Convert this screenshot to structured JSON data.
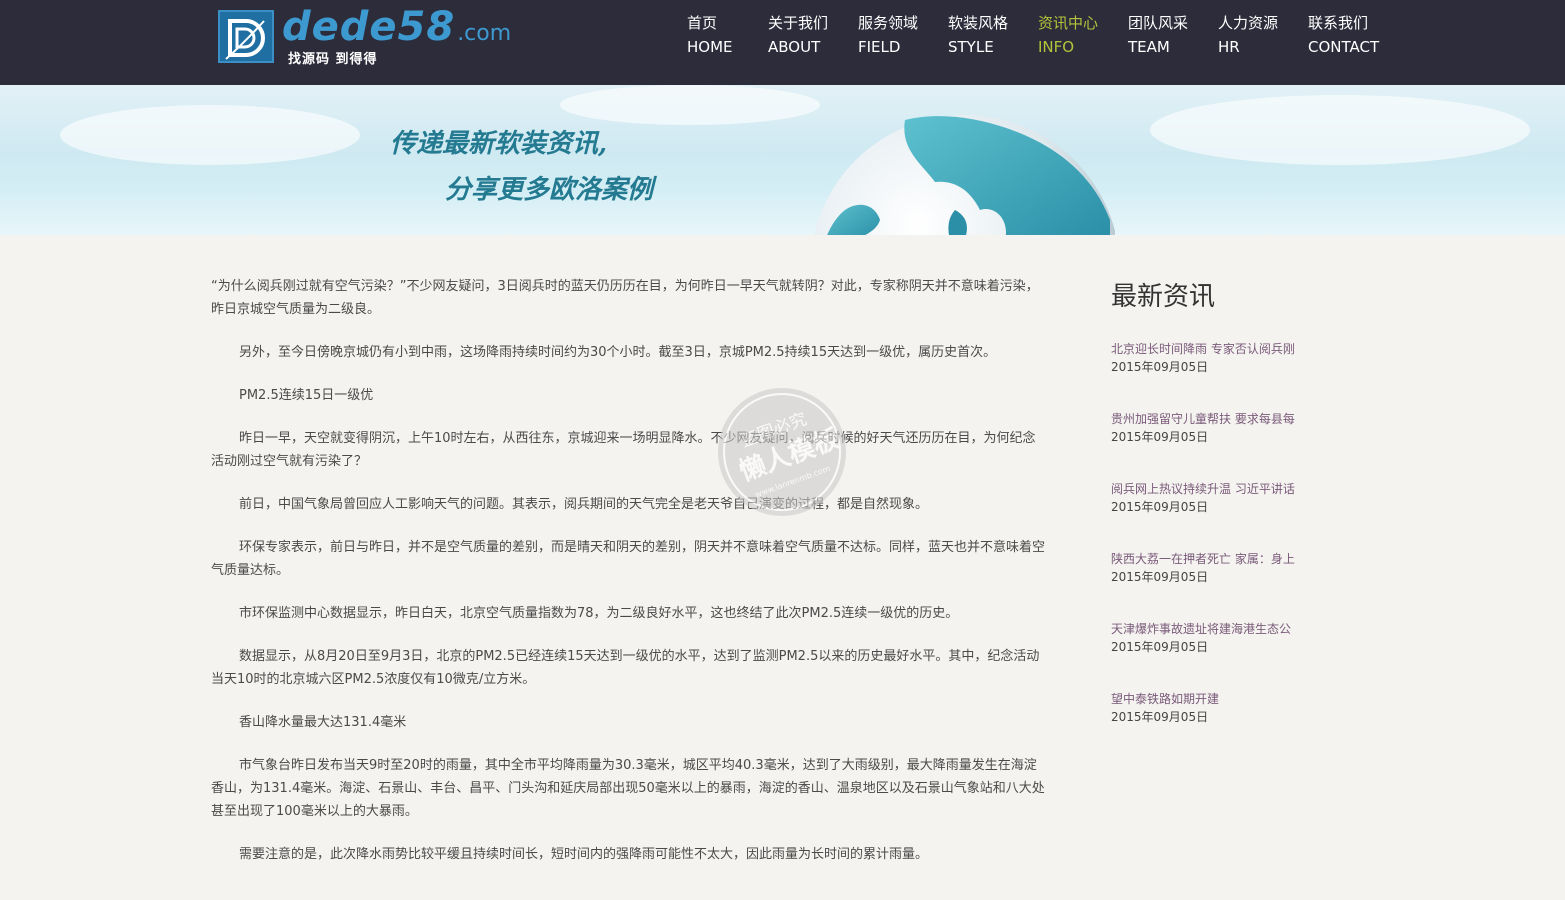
{
  "header": {
    "logo": {
      "icon": "dede-logo-icon",
      "brand": "dede58",
      "domain_suffix": ".com",
      "slogan": "找源码 到得得"
    },
    "nav": [
      {
        "cn": "首页",
        "en": "HOME",
        "active": false
      },
      {
        "cn": "关于我们",
        "en": "ABOUT",
        "active": false
      },
      {
        "cn": "服务领域",
        "en": "FIELD",
        "active": false
      },
      {
        "cn": "软装风格",
        "en": "STYLE",
        "active": false
      },
      {
        "cn": "资讯中心",
        "en": "INFO",
        "active": true
      },
      {
        "cn": "团队风采",
        "en": "TEAM",
        "active": false
      },
      {
        "cn": "人力资源",
        "en": "HR",
        "active": false
      },
      {
        "cn": "联系我们",
        "en": "CONTACT",
        "active": false
      }
    ]
  },
  "banner": {
    "line1": "传递最新软装资讯,",
    "line2": "分享更多欧洛案例",
    "image": "globe-icon"
  },
  "article": {
    "paragraphs": [
      "“为什么阅兵刚过就有空气污染？”不少网友疑问，3日阅兵时的蓝天仍历历在目，为何昨日一早天气就转阴？对此，专家称阴天并不意味着污染，昨日京城空气质量为二级良。",
      "另外，至今日傍晚京城仍有小到中雨，这场降雨持续时间约为30个小时。截至3日，京城PM2.5持续15天达到一级优，属历史首次。",
      "PM2.5连续15日一级优",
      "昨日一早，天空就变得阴沉，上午10时左右，从西往东，京城迎来一场明显降水。不少网友疑问，阅兵时候的好天气还历历在目，为何纪念活动刚过空气就有污染了？",
      "前日，中国气象局曾回应人工影响天气的问题。其表示，阅兵期间的天气完全是老天爷自己演变的过程，都是自然现象。",
      "环保专家表示，前日与昨日，并不是空气质量的差别，而是晴天和阴天的差别，阴天并不意味着空气质量不达标。同样，蓝天也并不意味着空气质量达标。",
      "市环保监测中心数据显示，昨日白天，北京空气质量指数为78，为二级良好水平，这也终结了此次PM2.5连续一级优的历史。",
      "数据显示，从8月20日至9月3日，北京的PM2.5已经连续15天达到一级优的水平，达到了监测PM2.5以来的历史最好水平。其中，纪念活动当天10时的北京城六区PM2.5浓度仅有10微克/立方米。",
      "香山降水量最大达131.4毫米",
      "市气象台昨日发布当天9时至20时的雨量，其中全市平均降雨量为30.3毫米，城区平均40.3毫米，达到了大雨级别，最大降雨量发生在海淀香山，为131.4毫米。海淀、石景山、丰台、昌平、门头沟和延庆局部出现50毫米以上的暴雨，海淀的香山、温泉地区以及石景山气象站和八大处甚至出现了100毫米以上的大暴雨。",
      "需要注意的是，此次降水雨势比较平缓且持续时间长，短时间内的强降雨可能性不太大，因此雨量为长时间的累计雨量。"
    ]
  },
  "sidebar": {
    "title": "最新资讯",
    "items": [
      {
        "title": "北京迎长时间降雨 专家否认阅兵刚",
        "date": "2015年09月05日"
      },
      {
        "title": "贵州加强留守儿童帮扶 要求每县每",
        "date": "2015年09月05日"
      },
      {
        "title": "阅兵网上热议持续升温 习近平讲话",
        "date": "2015年09月05日"
      },
      {
        "title": "陕西大荔一在押者死亡 家属：身上",
        "date": "2015年09月05日"
      },
      {
        "title": "天津爆炸事故遗址将建海港生态公",
        "date": "2015年09月05日"
      },
      {
        "title": "望中泰铁路如期开建",
        "date": "2015年09月05日"
      }
    ]
  },
  "watermark": {
    "line1": "盗图必究",
    "line2": "懒人模板",
    "url": "www.lanrenmb.com"
  },
  "colors": {
    "header_bg": "#2d2c3b",
    "nav_active": "#b4c43a",
    "banner_text": "#237a91",
    "page_bg": "#f4f3ef",
    "sidebar_link": "#7a5a7a"
  }
}
